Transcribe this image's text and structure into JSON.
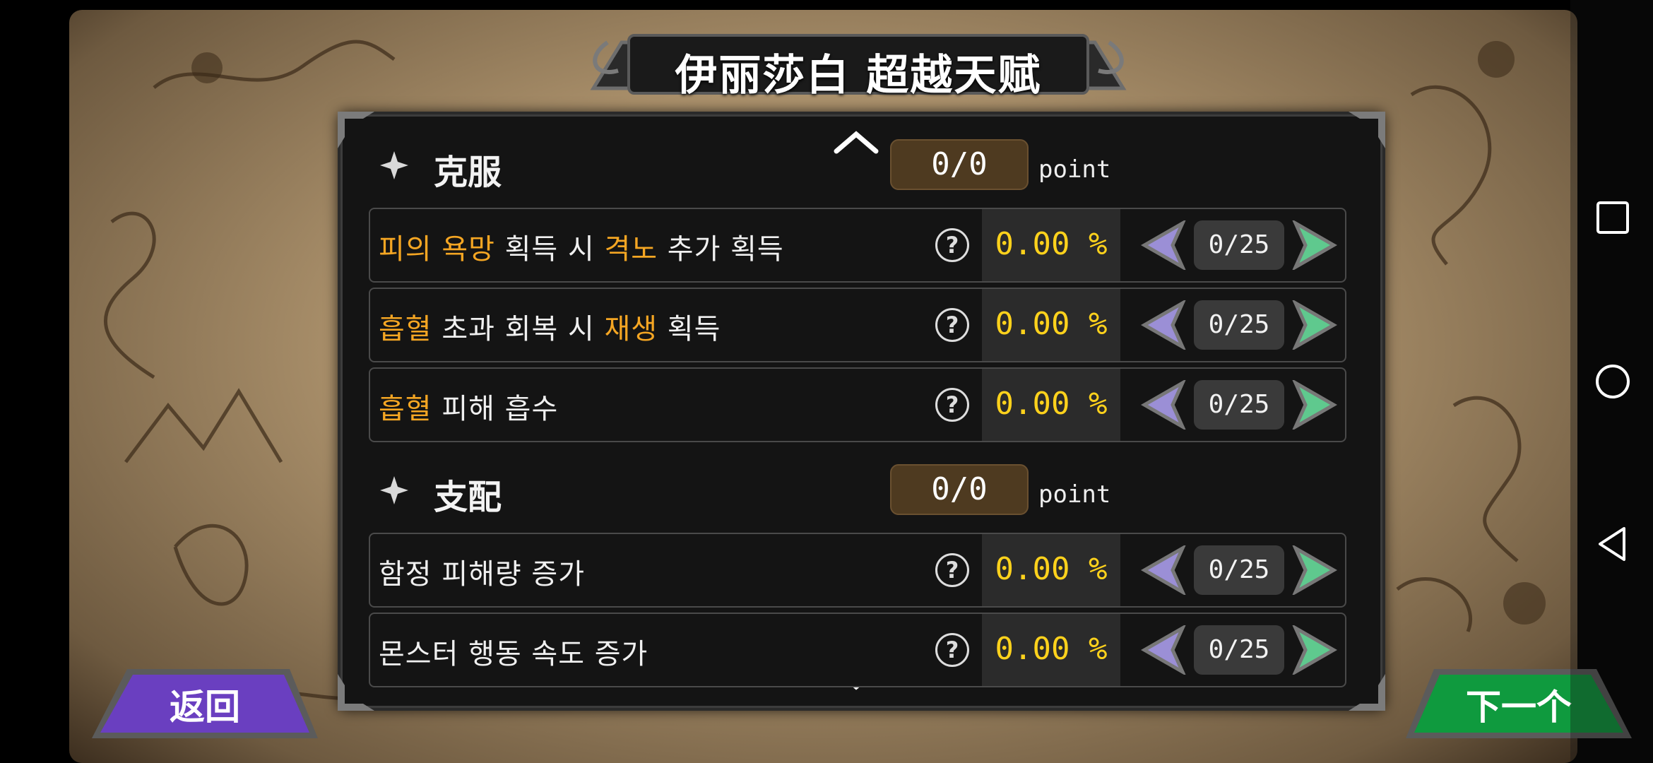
{
  "title": "伊丽莎白 超越天赋",
  "sections": [
    {
      "name": "克服",
      "points": "0/0",
      "unit": "point",
      "rows": [
        {
          "parts": [
            [
              "피의 욕망",
              true
            ],
            [
              " 획득 시 ",
              false
            ],
            [
              "격노",
              true
            ],
            [
              " 추가 획득",
              false
            ]
          ],
          "help": "?",
          "percent": "0.00 %",
          "counter": "0/25"
        },
        {
          "parts": [
            [
              "흡혈",
              true
            ],
            [
              " 초과 회복 시 ",
              false
            ],
            [
              "재생",
              true
            ],
            [
              " 획득",
              false
            ]
          ],
          "help": "?",
          "percent": "0.00 %",
          "counter": "0/25"
        },
        {
          "parts": [
            [
              "흡혈",
              true
            ],
            [
              " 피해 흡수",
              false
            ]
          ],
          "help": "?",
          "percent": "0.00 %",
          "counter": "0/25"
        }
      ]
    },
    {
      "name": "支配",
      "points": "0/0",
      "unit": "point",
      "rows": [
        {
          "parts": [
            [
              "함정 피해량 증가",
              false
            ]
          ],
          "help": "?",
          "percent": "0.00 %",
          "counter": "0/25"
        },
        {
          "parts": [
            [
              "몬스터 행동 속도 증가",
              false
            ]
          ],
          "help": "?",
          "percent": "0.00 %",
          "counter": "0/25"
        }
      ]
    }
  ],
  "buttons": {
    "back": "返回",
    "next": "下一个"
  },
  "colors": {
    "highlight": "#f5a623",
    "percent": "#ffd21c",
    "back": "#6a3fc0",
    "next": "#0f9a3e"
  },
  "icons": [
    "scroll-up-icon",
    "scroll-down-icon",
    "star-icon",
    "help-icon",
    "decrease-arrow-icon",
    "increase-arrow-icon",
    "nav-recents-icon",
    "nav-home-icon",
    "nav-back-icon"
  ]
}
